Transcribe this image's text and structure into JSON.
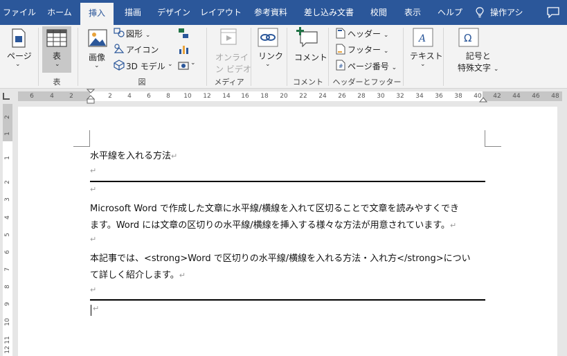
{
  "tabs": [
    "ファイル",
    "ホーム",
    "挿入",
    "描画",
    "デザイン",
    "レイアウト",
    "参考資料",
    "差し込み文書",
    "校閲",
    "表示",
    "ヘルプ"
  ],
  "active_tab": "挿入",
  "tell_me": "操作アシ",
  "ribbon": {
    "page_btn": "ページ",
    "table_btn": "表",
    "image_btn": "画像",
    "shapes_btn": "図形",
    "icons_btn": "アイコン",
    "model3d_btn": "3D モデル",
    "online_video_line1": "オンライ",
    "online_video_line2": "ン ビデオ",
    "link_btn": "リンク",
    "comment_btn": "コメント",
    "header_btn": "ヘッダー",
    "footer_btn": "フッター",
    "page_number_btn": "ページ番号",
    "text_btn": "テキスト",
    "symbol_line1": "記号と",
    "symbol_line2": "特殊文字",
    "groups": {
      "table": "表",
      "illustrations": "図",
      "media": "メディア",
      "comments": "コメント",
      "header_footer": "ヘッダーとフッター"
    }
  },
  "ruler": {
    "h_numbers": [
      "6",
      "4",
      "2",
      "2",
      "4",
      "6",
      "8",
      "10",
      "12",
      "14",
      "16",
      "18",
      "20",
      "22",
      "24",
      "26",
      "28",
      "30",
      "32",
      "34",
      "36",
      "38",
      "40",
      "42",
      "44",
      "46",
      "48"
    ],
    "v_numbers": [
      "2",
      "1",
      "1",
      "2",
      "3",
      "4",
      "5",
      "6",
      "7",
      "8",
      "9",
      "10",
      "11",
      "12"
    ]
  },
  "document": {
    "title_line": "水平線を入れる方法",
    "para1_line1": "Microsoft Word で作成した文章に水平線/横線を入れて区切ることで文章を読みやすくでき",
    "para1_line2": "ます。Word には文章の区切りの水平線/横線を挿入する様々な方法が用意されています。",
    "para2_line1": "本記事では、<strong>Word で区切りの水平線/横線を入れる方法・入れ方</strong>につい",
    "para2_line2": "て詳しく紹介します。",
    "para_mark": "↵"
  },
  "colors": {
    "tab_bar": "#2b579a",
    "ribbon": "#f3f3f3",
    "accent_green": "#217346",
    "icon_blue": "#2b579a"
  }
}
